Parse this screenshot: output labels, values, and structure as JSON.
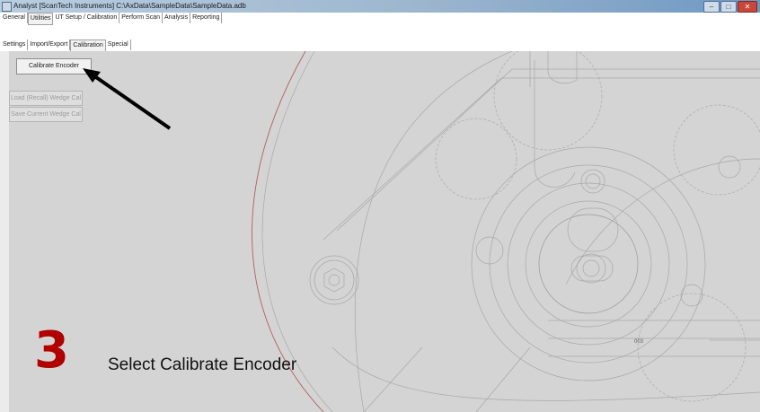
{
  "window": {
    "title": "Analyst [ScanTech Instruments] C:\\AxData\\SampleData\\SampleData.adb",
    "controls": {
      "minimize": "–",
      "maximize": "□",
      "close": "✕"
    }
  },
  "main_tabs": [
    {
      "label": "General",
      "active": false
    },
    {
      "label": "Utilities",
      "active": true
    },
    {
      "label": "UT Setup / Calibration",
      "active": false
    },
    {
      "label": "Perform Scan",
      "active": false
    },
    {
      "label": "Analysis",
      "active": false
    },
    {
      "label": "Reporting",
      "active": false
    }
  ],
  "sub_tabs": [
    {
      "label": "Settings",
      "active": false
    },
    {
      "label": "Import/Export",
      "active": false
    },
    {
      "label": "Calibration",
      "active": true
    },
    {
      "label": "Special",
      "active": false
    }
  ],
  "buttons": {
    "calibrate_encoder": "Calibrate Encoder",
    "load_wedge": "Load (Recall) Wedge Cal",
    "save_wedge": "Save Current Wedge Cal"
  },
  "drawing_label": "003",
  "annotation": {
    "step_number": "3",
    "step_text": "Select Calibrate Encoder"
  },
  "colors": {
    "step_number": "#b00000",
    "panel_background": "#d4d4d4"
  }
}
